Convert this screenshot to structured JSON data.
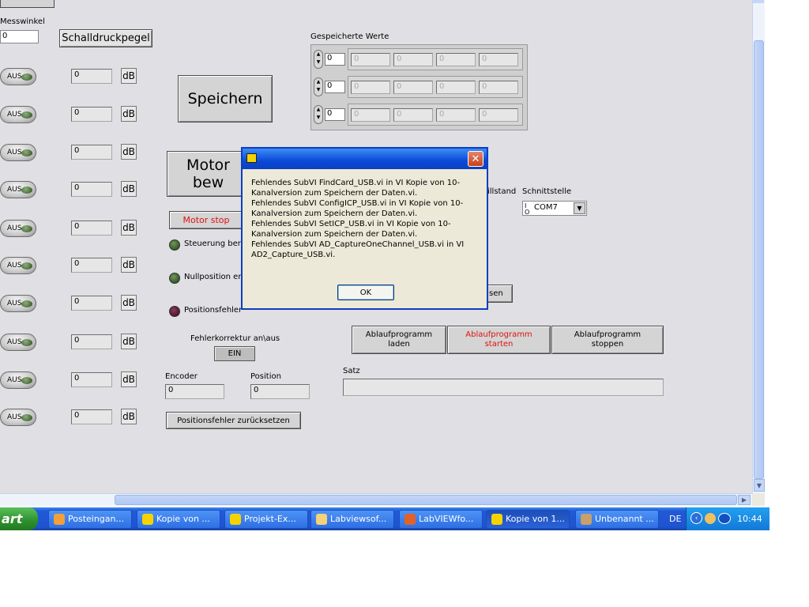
{
  "panel": {
    "messwinkel_label": "Messwinkel",
    "messwinkel_value": "0",
    "schalldruckpegel_label": "Schalldruckpegel",
    "aus_label": "AUS",
    "channel_values": [
      "0",
      "0",
      "0",
      "0",
      "0",
      "0",
      "0",
      "0",
      "0",
      "0"
    ],
    "unit_label": "dB",
    "speichern_label": "Speichern",
    "gespeicherte_label": "Gespeicherte Werte",
    "saved_rows": [
      {
        "index": "0",
        "values": [
          "0",
          "0",
          "0",
          "0"
        ]
      },
      {
        "index": "0",
        "values": [
          "0",
          "0",
          "0",
          "0"
        ]
      },
      {
        "index": "0",
        "values": [
          "0",
          "0",
          "0",
          "0"
        ]
      }
    ],
    "motor_bewegen_label": "Motor bew",
    "motor_stop_label": "Motor stop",
    "steuerung_label": "Steuerung bere",
    "nullposition_label": "Nullposition err",
    "positionsfehler_label": "Positionsfehler",
    "fehlerkorrektur_label": "Fehlerkorrektur an\\aus",
    "ein_label": "EIN",
    "encoder_label": "Encoder",
    "encoder_value": "0",
    "position_label": "Position",
    "position_value": "0",
    "reset_button_label": "Positionsfehler zurücksetzen",
    "stillstand_label": "illstand",
    "schnittstelle_label": "Schnittstelle",
    "com_value": "COM7",
    "partial_button_label": "sen",
    "ablauf_laden_label": "Ablaufprogramm\nladen",
    "ablauf_starten_label": "Ablaufprogramm\nstarten",
    "ablauf_stoppen_label": "Ablaufprogramm\nstoppen",
    "satz_label": "Satz",
    "satz_value": ""
  },
  "dialog": {
    "message": "Fehlendes SubVI FindCard_USB.vi in VI Kopie von 10-\nKanalversion zum Speichern der Daten.vi.\nFehlendes SubVI ConfigICP_USB.vi in VI Kopie von 10-\nKanalversion zum Speichern der Daten.vi.\nFehlendes SubVI SetICP_USB.vi in VI Kopie von 10-\nKanalversion zum Speichern der Daten.vi.\nFehlendes SubVI AD_CaptureOneChannel_USB.vi in VI\nAD2_Capture_USB.vi.",
    "ok_label": "OK",
    "close_glyph": "✕"
  },
  "taskbar": {
    "start_label": "art",
    "items": [
      {
        "label": "Posteingan...",
        "icon": "mail-icon"
      },
      {
        "label": "Kopie von ...",
        "icon": "labview-icon"
      },
      {
        "label": "Projekt-Ex...",
        "icon": "labview-icon"
      },
      {
        "label": "Labviewsof...",
        "icon": "folder-icon"
      },
      {
        "label": "LabVIEWfo...",
        "icon": "firefox-icon"
      },
      {
        "label": "Kopie von 1...",
        "icon": "labview-icon"
      },
      {
        "label": "Unbenannt ...",
        "icon": "paint-icon"
      }
    ],
    "language": "DE",
    "clock": "10:44"
  },
  "colors": {
    "panel_bg": "#e0dfe3",
    "red_text": "#e01010",
    "taskbar_blue": "#2259d6"
  }
}
